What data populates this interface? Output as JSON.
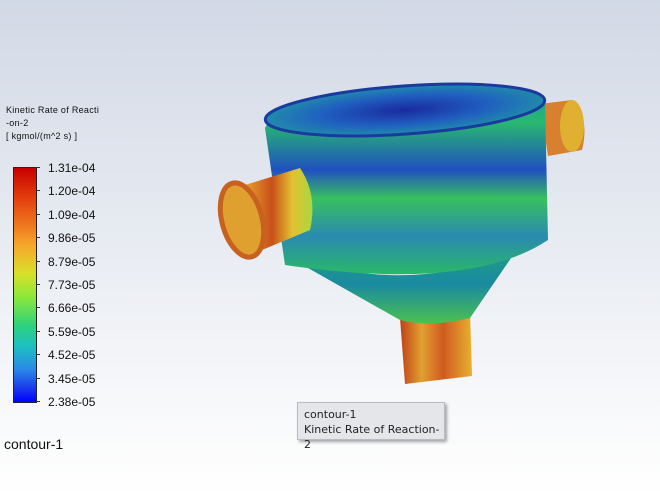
{
  "legend": {
    "title_line1": "Kinetic Rate of Reacti",
    "title_line2": "-on-2",
    "units": "[ kgmol/(m^2 s) ]",
    "ticks": [
      "1.31e-04",
      "1.20e-04",
      "1.09e-04",
      "9.86e-05",
      "8.79e-05",
      "7.73e-05",
      "6.66e-05",
      "5.59e-05",
      "4.52e-05",
      "3.45e-05",
      "2.38e-05"
    ],
    "min": 2.38e-05,
    "max": 0.000131
  },
  "footer": {
    "label": "contour-1"
  },
  "tooltip": {
    "line1": "contour-1",
    "line2": "Kinetic Rate of Reaction-2"
  }
}
